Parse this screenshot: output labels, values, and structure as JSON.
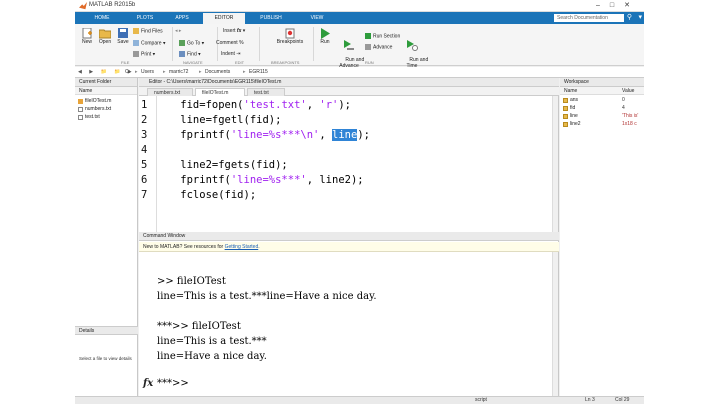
{
  "window": {
    "title": "MATLAB R2015b",
    "controls": [
      "–",
      "□",
      "✕"
    ]
  },
  "tabs": [
    "HOME",
    "PLOTS",
    "APPS",
    "EDITOR",
    "PUBLISH",
    "VIEW"
  ],
  "active_tab": "EDITOR",
  "search": {
    "placeholder": "Search Documentation"
  },
  "ribbon": {
    "file": {
      "new": "New",
      "open": "Open",
      "save": "Save",
      "find_files": "Find Files",
      "compare": "Compare",
      "print": "Print"
    },
    "navigate": {
      "go_to": "Go To",
      "find": "Find"
    },
    "edit": {
      "insert": "Insert",
      "fx": "fx",
      "comment": "Comment",
      "indent": "Indent"
    },
    "breakpoints": {
      "label": "Breakpoints"
    },
    "run": {
      "run": "Run",
      "run_and_advance": "Run and\nAdvance",
      "run_section": "Run Section",
      "advance": "Advance",
      "run_and_time": "Run and\nTime"
    },
    "sections": [
      "FILE",
      "NAVIGATE",
      "EDIT",
      "BREAKPOINTS",
      "RUN"
    ]
  },
  "address": {
    "nav": "◀ ▶ 📁 📁 ▶",
    "crumbs": [
      "C:",
      "Users",
      "marric72",
      "Documents",
      "EGR115"
    ]
  },
  "current_folder": {
    "title": "Current Folder",
    "column": "Name",
    "files": [
      "fileIOTest.m",
      "numbers.txt",
      "test.txt"
    ],
    "details_label": "Details",
    "hint": "Select a file to view details"
  },
  "editor": {
    "title": "Editor - C:\\Users\\marric72\\Documents\\EGR115\\fileIOTest.m",
    "tabs": [
      "numbers.txt",
      "fileIOTest.m",
      "test.txt"
    ],
    "active_tab": "fileIOTest.m",
    "lines": [
      {
        "num": "1",
        "pre": "    fid=fopen(",
        "s1": "'test.txt'",
        "mid": ", ",
        "s2": "'r'",
        "post": ");"
      },
      {
        "num": "2",
        "pre": "    line=fgetl(fid);",
        "s1": "",
        "mid": "",
        "s2": "",
        "post": ""
      },
      {
        "num": "3",
        "pre": "    fprintf(",
        "s1": "'line=%s***\\n'",
        "mid": ", ",
        "s2": "",
        "post": ");",
        "highlight": "line"
      },
      {
        "num": "4",
        "pre": "",
        "s1": "",
        "mid": "",
        "s2": "",
        "post": ""
      },
      {
        "num": "5",
        "pre": "    line2=fgets(fid);",
        "s1": "",
        "mid": "",
        "s2": "",
        "post": ""
      },
      {
        "num": "6",
        "pre": "    fprintf(",
        "s1": "'line=%s***'",
        "mid": ", line2);",
        "s2": "",
        "post": ""
      },
      {
        "num": "7",
        "pre": "    fclose(fid);",
        "s1": "",
        "mid": "",
        "s2": "",
        "post": ""
      }
    ]
  },
  "command_window": {
    "title": "Command Window",
    "new_notice": "New to MATLAB? See resources for ",
    "new_link": "Getting Started",
    "new_tail": ".",
    "output": [
      ">> fileIOTest",
      "line=This is a test.***line=Have a nice day.",
      "",
      "***>> fileIOTest",
      "line=This is a test.***",
      "line=Have a nice day."
    ],
    "prompt": "***>>",
    "fx": "fx"
  },
  "workspace": {
    "title": "Workspace",
    "columns": [
      "Name",
      "Value"
    ],
    "vars": [
      {
        "name": "ans",
        "value": "0"
      },
      {
        "name": "fid",
        "value": "4"
      },
      {
        "name": "line",
        "value": "'This is'"
      },
      {
        "name": "line2",
        "value": "1x18 c"
      }
    ]
  },
  "status": {
    "mode": "script",
    "ln": "Ln 3",
    "col": "Col 29"
  }
}
